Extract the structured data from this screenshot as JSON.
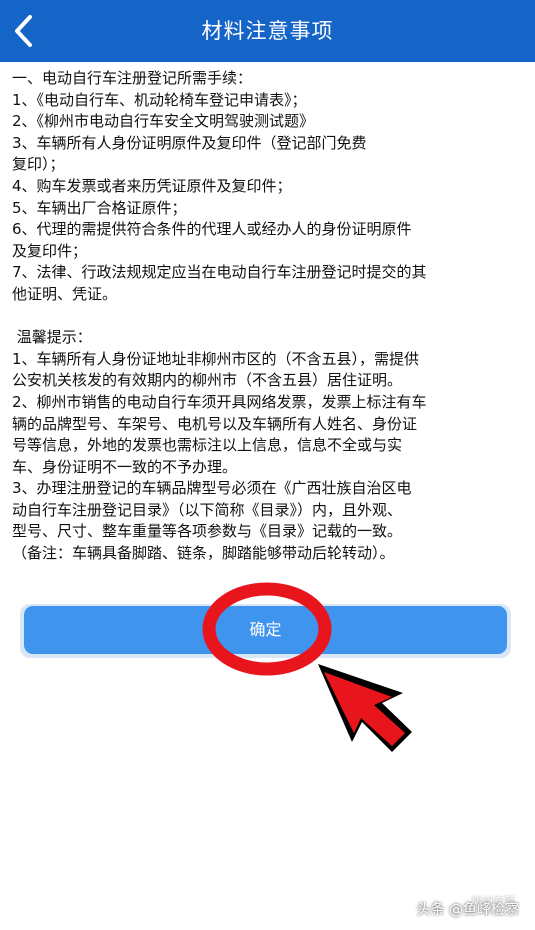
{
  "header": {
    "title": "材料注意事项",
    "back_icon": "chevron-left-icon",
    "bg_color": "#1565c8"
  },
  "content": {
    "lines": [
      "一、电动自行车注册登记所需手续：",
      "1、《电动自行车、机动轮椅车登记申请表》；",
      "2、《柳州市电动自行车安全文明驾驶测试题》",
      "3、车辆所有人身份证明原件及复印件（登记部门免费",
      "复印）；",
      "4、购车发票或者来历凭证原件及复印件；",
      "5、车辆出厂合格证原件；",
      "6、代理的需提供符合条件的代理人或经办人的身份证明原件",
      "及复印件；",
      "7、法律、行政法规规定应当在电动自行车注册登记时提交的其",
      "他证明、凭证。",
      "",
      " 温馨提示：",
      "1、车辆所有人身份证地址非柳州市区的（不含五县），需提供",
      "公安机关核发的有效期内的柳州市（不含五县）居住证明。",
      "2、柳州市销售的电动自行车须开具网络发票，发票上标注有车",
      "辆的品牌型号、车架号、电机号以及车辆所有人姓名、身份证",
      "号等信息，外地的发票也需标注以上信息，信息不全或与实",
      "车、身份证明不一致的不予办理。",
      "3、办理注册登记的车辆品牌型号必须在《广西壮族自治区电",
      "动自行车注册登记目录》（以下简称《目录》）内，且外观、",
      "型号、尺寸、整车重量等各项参数与《目录》记载的一致。",
      "（备注：车辆具备脚踏、链条，脚踏能够带动后轮转动）。"
    ]
  },
  "confirm_button": {
    "label": "确定",
    "color": "#3f94ee"
  },
  "annotation": {
    "color": "#e8161c"
  },
  "watermark": {
    "text": "头条 @鱼峰检察",
    "faint_text": "柳州交警"
  }
}
